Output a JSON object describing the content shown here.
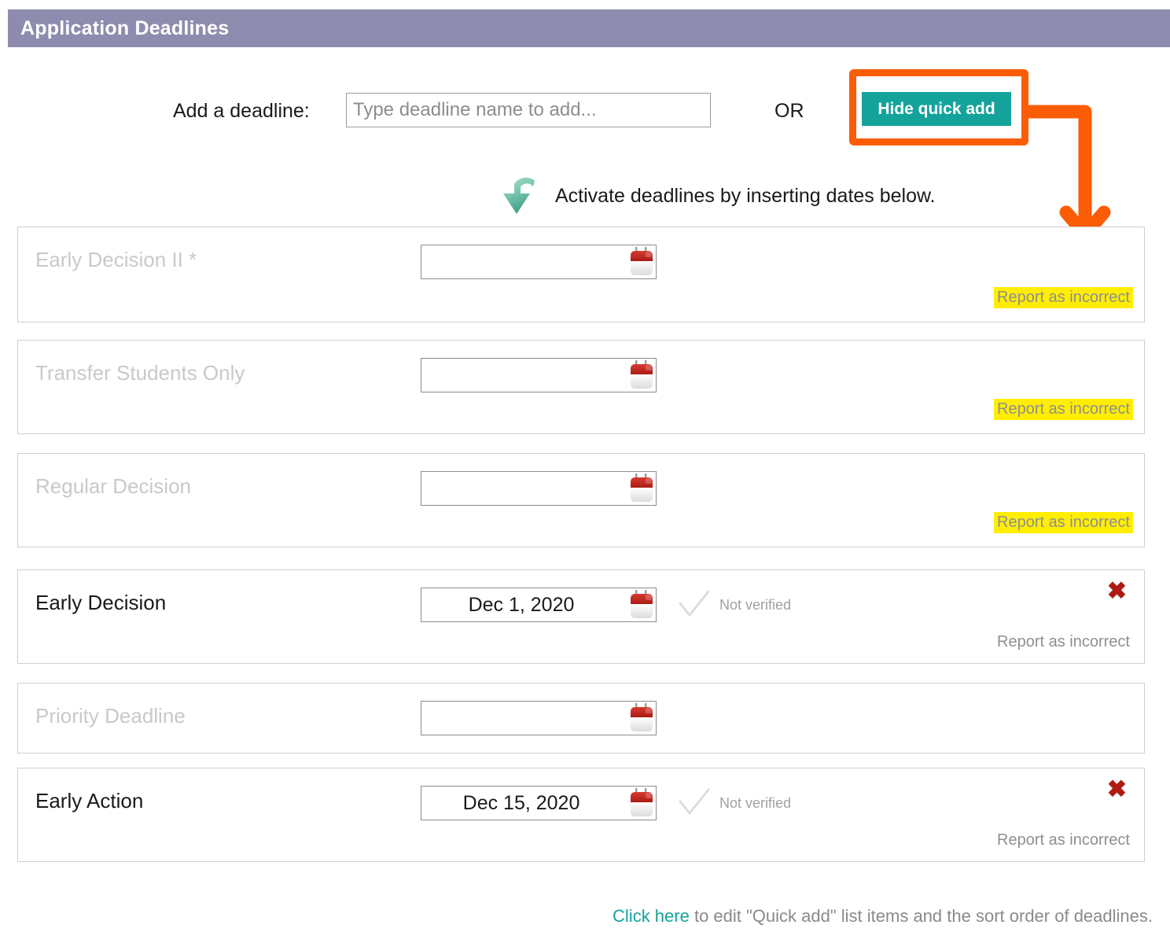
{
  "header": {
    "title": "Application Deadlines"
  },
  "toolbar": {
    "add_label": "Add a deadline:",
    "input_placeholder": "Type deadline name to add...",
    "input_value": "",
    "or_label": "OR",
    "hide_quick_add_label": "Hide quick add",
    "annotation_color": "#fa5d06",
    "button_color": "#13a39b"
  },
  "hint": {
    "text": "Activate deadlines by inserting dates below.",
    "icon": "green-curved-down-arrow-icon"
  },
  "rows": [
    {
      "name": "Early Decision II *",
      "active": false,
      "date": "",
      "verified_label": "",
      "has_verify": false,
      "has_delete": false,
      "report_label": "Report as incorrect",
      "report_highlighted": true
    },
    {
      "name": "Transfer Students Only",
      "active": false,
      "date": "",
      "verified_label": "",
      "has_verify": false,
      "has_delete": false,
      "report_label": "Report as incorrect",
      "report_highlighted": true
    },
    {
      "name": "Regular Decision",
      "active": false,
      "date": "",
      "verified_label": "",
      "has_verify": false,
      "has_delete": false,
      "report_label": "Report as incorrect",
      "report_highlighted": true
    },
    {
      "name": "Early Decision",
      "active": true,
      "date": "Dec 1, 2020",
      "verified_label": "Not verified",
      "has_verify": true,
      "has_delete": true,
      "report_label": "Report as incorrect",
      "report_highlighted": false
    },
    {
      "name": "Priority Deadline",
      "active": false,
      "date": "",
      "verified_label": "",
      "has_verify": false,
      "has_delete": false,
      "report_label": "",
      "report_highlighted": false
    },
    {
      "name": "Early Action",
      "active": true,
      "date": "Dec 15, 2020",
      "verified_label": "Not verified",
      "has_verify": true,
      "has_delete": true,
      "report_label": "Report as incorrect",
      "report_highlighted": false
    }
  ],
  "footer": {
    "link_text": "Click here",
    "rest_text": " to edit \"Quick add\" list items and the sort order of deadlines."
  },
  "icons": {
    "calendar": "calendar-icon",
    "check": "check-outline-icon",
    "delete": "delete-x-icon"
  }
}
